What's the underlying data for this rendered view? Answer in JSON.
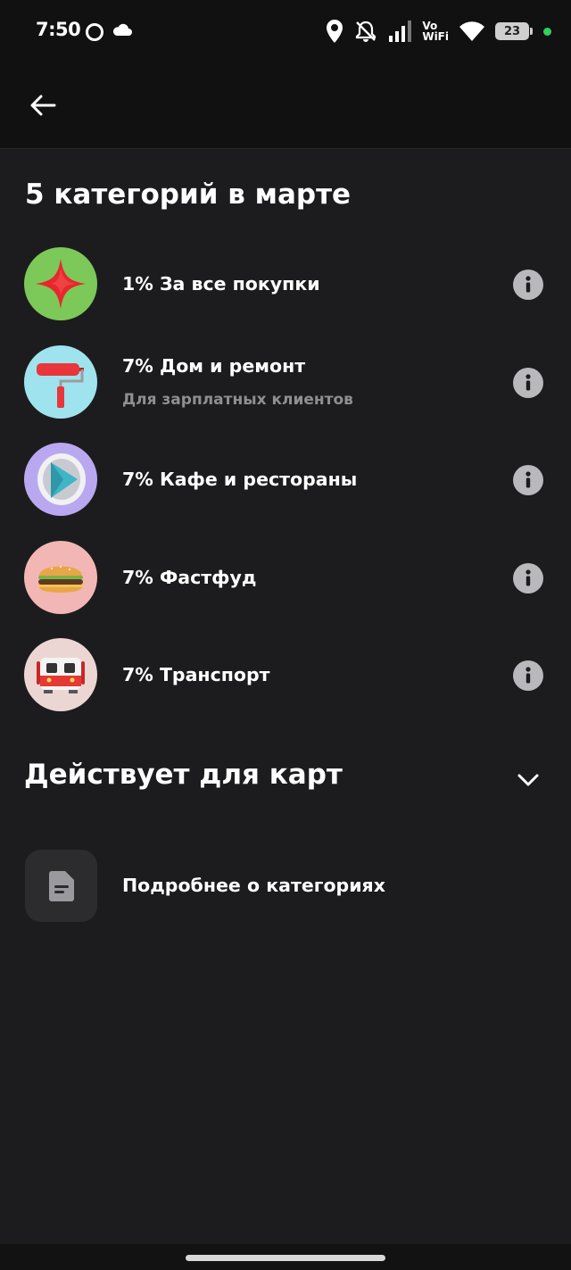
{
  "status_bar": {
    "time": "7:50",
    "vowifi_top": "Vo",
    "vowifi_bottom": "WiFi",
    "battery": "23",
    "icons": [
      "record-icon",
      "cloud-icon",
      "location-icon",
      "mute-icon",
      "signal-icon",
      "wifi-icon",
      "battery-icon",
      "charging-dot-icon"
    ]
  },
  "header": {
    "back_icon": "arrow-left-icon"
  },
  "section_title": "5 категорий в марте",
  "categories": [
    {
      "label": "1% За все покупки",
      "subtitle": "",
      "icon": "sparkle-star-icon",
      "icon_bg": "#7cc858"
    },
    {
      "label": "7% Дом и ремонт",
      "subtitle": "Для зарплатных клиентов",
      "icon": "paint-roller-icon",
      "icon_bg": "#9fe3ef"
    },
    {
      "label": "7% Кафе и рестораны",
      "subtitle": "",
      "icon": "play-triangle-icon",
      "icon_bg": "#b9a8f0"
    },
    {
      "label": "7% Фастфуд",
      "subtitle": "",
      "icon": "burger-icon",
      "icon_bg": "#f2b7b4"
    },
    {
      "label": "7% Транспорт",
      "subtitle": "",
      "icon": "tram-icon",
      "icon_bg": "#ecd6d4"
    }
  ],
  "cards_section": {
    "title": "Действует для карт",
    "chevron_icon": "chevron-down-icon"
  },
  "details": {
    "label": "Подробнее о категориях",
    "icon": "document-icon"
  },
  "colors": {
    "background": "#1c1c1e",
    "header": "#111111",
    "info_icon": "#b9b9bd",
    "muted_text": "#8e8e93"
  }
}
